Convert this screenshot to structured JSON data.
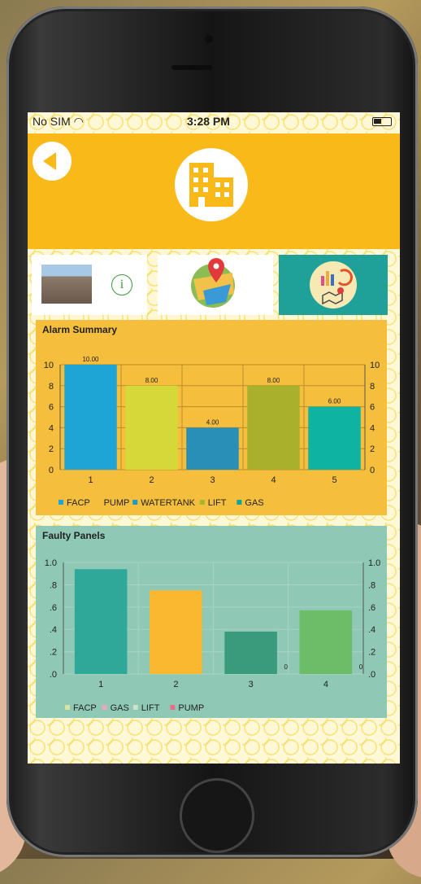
{
  "status_bar": {
    "carrier": "No SIM",
    "time": "3:28 PM"
  },
  "header": {
    "back_icon": "back-arrow-icon",
    "center_icon": "building-icon"
  },
  "nav": {
    "building_photo": "building-photo",
    "info_label": "i",
    "map_icon": "map-pin-icon",
    "analytics_icon": "chart-map-icon"
  },
  "alarm_summary": {
    "title": "Alarm Summary",
    "legend": [
      {
        "label": "FACP",
        "color": "#1ea5d6"
      },
      {
        "label": "PUMP",
        "color": "#f5be3c"
      },
      {
        "label": "WATERTANK",
        "color": "#1e9ac6"
      },
      {
        "label": "LIFT",
        "color": "#a8b62b"
      },
      {
        "label": "GAS",
        "color": "#0fa597"
      }
    ]
  },
  "faulty_panels": {
    "title": "Faulty Panels",
    "legend": [
      {
        "label": "FACP",
        "color": "#d9e4a3"
      },
      {
        "label": "GAS",
        "color": "#e8a7c4"
      },
      {
        "label": "LIFT",
        "color": "#cfe0c8"
      },
      {
        "label": "PUMP",
        "color": "#e86d8d"
      }
    ]
  },
  "chart_data": [
    {
      "type": "bar",
      "title": "Alarm Summary",
      "categories": [
        "1",
        "2",
        "3",
        "4",
        "5"
      ],
      "values": [
        10.0,
        8.0,
        4.0,
        8.0,
        6.0
      ],
      "value_labels": [
        "10.00",
        "8.00",
        "4.00",
        "8.00",
        "6.00"
      ],
      "colors": [
        "#1ea5d6",
        "#d6d83a",
        "#2a8fb6",
        "#a9b12c",
        "#0fb3a2"
      ],
      "ylim": [
        0,
        10
      ],
      "yticks": [
        "0",
        "2",
        "4",
        "6",
        "8",
        "10"
      ],
      "grid": true,
      "legend_position": "bottom"
    },
    {
      "type": "bar",
      "title": "Faulty Panels",
      "categories": [
        "1",
        "2",
        "3",
        "4"
      ],
      "series": [
        {
          "values": [
            0.94,
            0.75,
            0.38,
            0.57
          ]
        }
      ],
      "colors": [
        "#2fa89a",
        "#f9b830",
        "#3a9a7c",
        "#6dbd68"
      ],
      "zero_labels": [
        {
          "category": "3",
          "label": "0"
        },
        {
          "category": "4",
          "label": "0"
        }
      ],
      "ylim": [
        0,
        1
      ],
      "yticks": [
        ".0",
        ".2",
        ".4",
        ".6",
        ".8",
        "1.0"
      ],
      "grid": true,
      "legend_position": "bottom"
    }
  ]
}
